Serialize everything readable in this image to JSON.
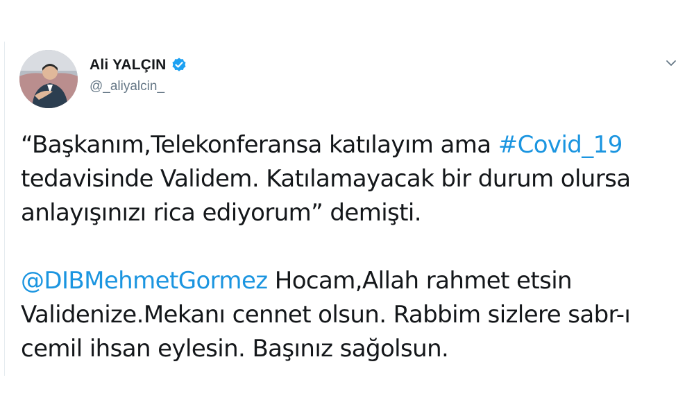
{
  "user": {
    "display_name": "Ali YALÇIN",
    "handle": "@_aliyalcin_",
    "verified": true,
    "avatar_icon": "user-avatar",
    "verified_icon": "verified-badge-icon"
  },
  "menu": {
    "icon": "chevron-down-icon"
  },
  "tweet": {
    "p1_l1_text": "“Başkanım,Telekonferansa katılayım ama ",
    "p1_l1_hashtag": "#Covid_19",
    "p1_l2": " tedavisinde Validem. Katılamayacak bir durum olursa",
    "p1_l3": "anlayışınızı rica ediyorum” demişti.",
    "p2_l1_mention": "@DIBMehmetGormez",
    "p2_l1_text": " Hocam,Allah rahmet etsin",
    "p2_l2": "Validenize.Mekanı cennet olsun. Rabbim sizlere sabr-ı",
    "p2_l3": "cemil ihsan eylesin. Başınız sağolsun."
  },
  "colors": {
    "link": "#1b95e0",
    "text": "#14171a",
    "secondary": "#657786",
    "verified": "#1da1f2"
  }
}
